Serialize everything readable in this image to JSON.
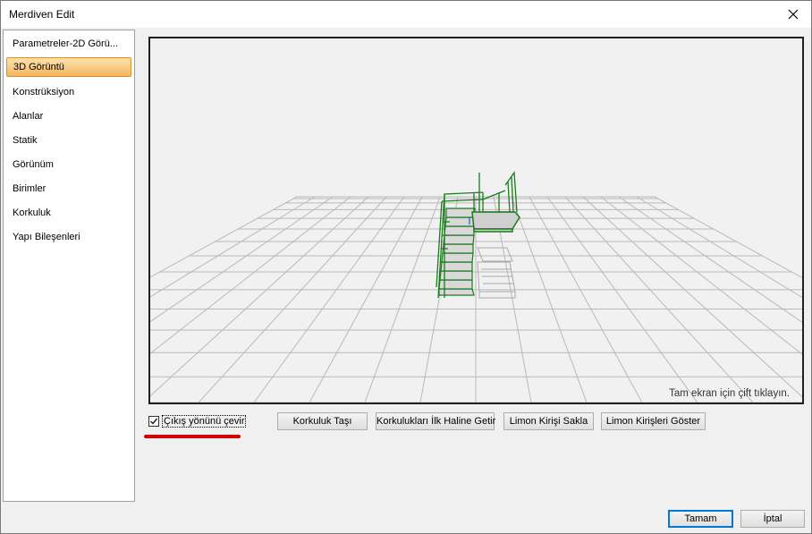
{
  "window": {
    "title": "Merdiven Edit"
  },
  "sidebar": {
    "items": [
      {
        "label": "Parametreler-2D Görü..."
      },
      {
        "label": "3D Görüntü"
      },
      {
        "label": "Konstrüksiyon"
      },
      {
        "label": "Alanlar"
      },
      {
        "label": "Statik"
      },
      {
        "label": "Görünüm"
      },
      {
        "label": "Birimler"
      },
      {
        "label": "Korkuluk"
      },
      {
        "label": "Yapı Bileşenleri"
      }
    ],
    "selected_index": 1
  },
  "viewport": {
    "hint": "Tam ekran için çift tıklayın."
  },
  "options": {
    "flip_exit_label": "Çıkış yönünü çevir",
    "flip_exit_checked": true
  },
  "actions": {
    "move_railing": "Korkuluk Taşı",
    "reset_railings": "Korkulukları İlk Haline Getir",
    "hide_stringer": "Limon Kirişi Sakla",
    "show_stringers": "Limon Kirişleri Göster"
  },
  "footer": {
    "ok": "Tamam",
    "cancel": "İptal"
  },
  "colors": {
    "accent": "#0078d7",
    "selection": "#f6b55b",
    "stair_green": "#1e7a1e",
    "annotation_red": "#d40000"
  }
}
